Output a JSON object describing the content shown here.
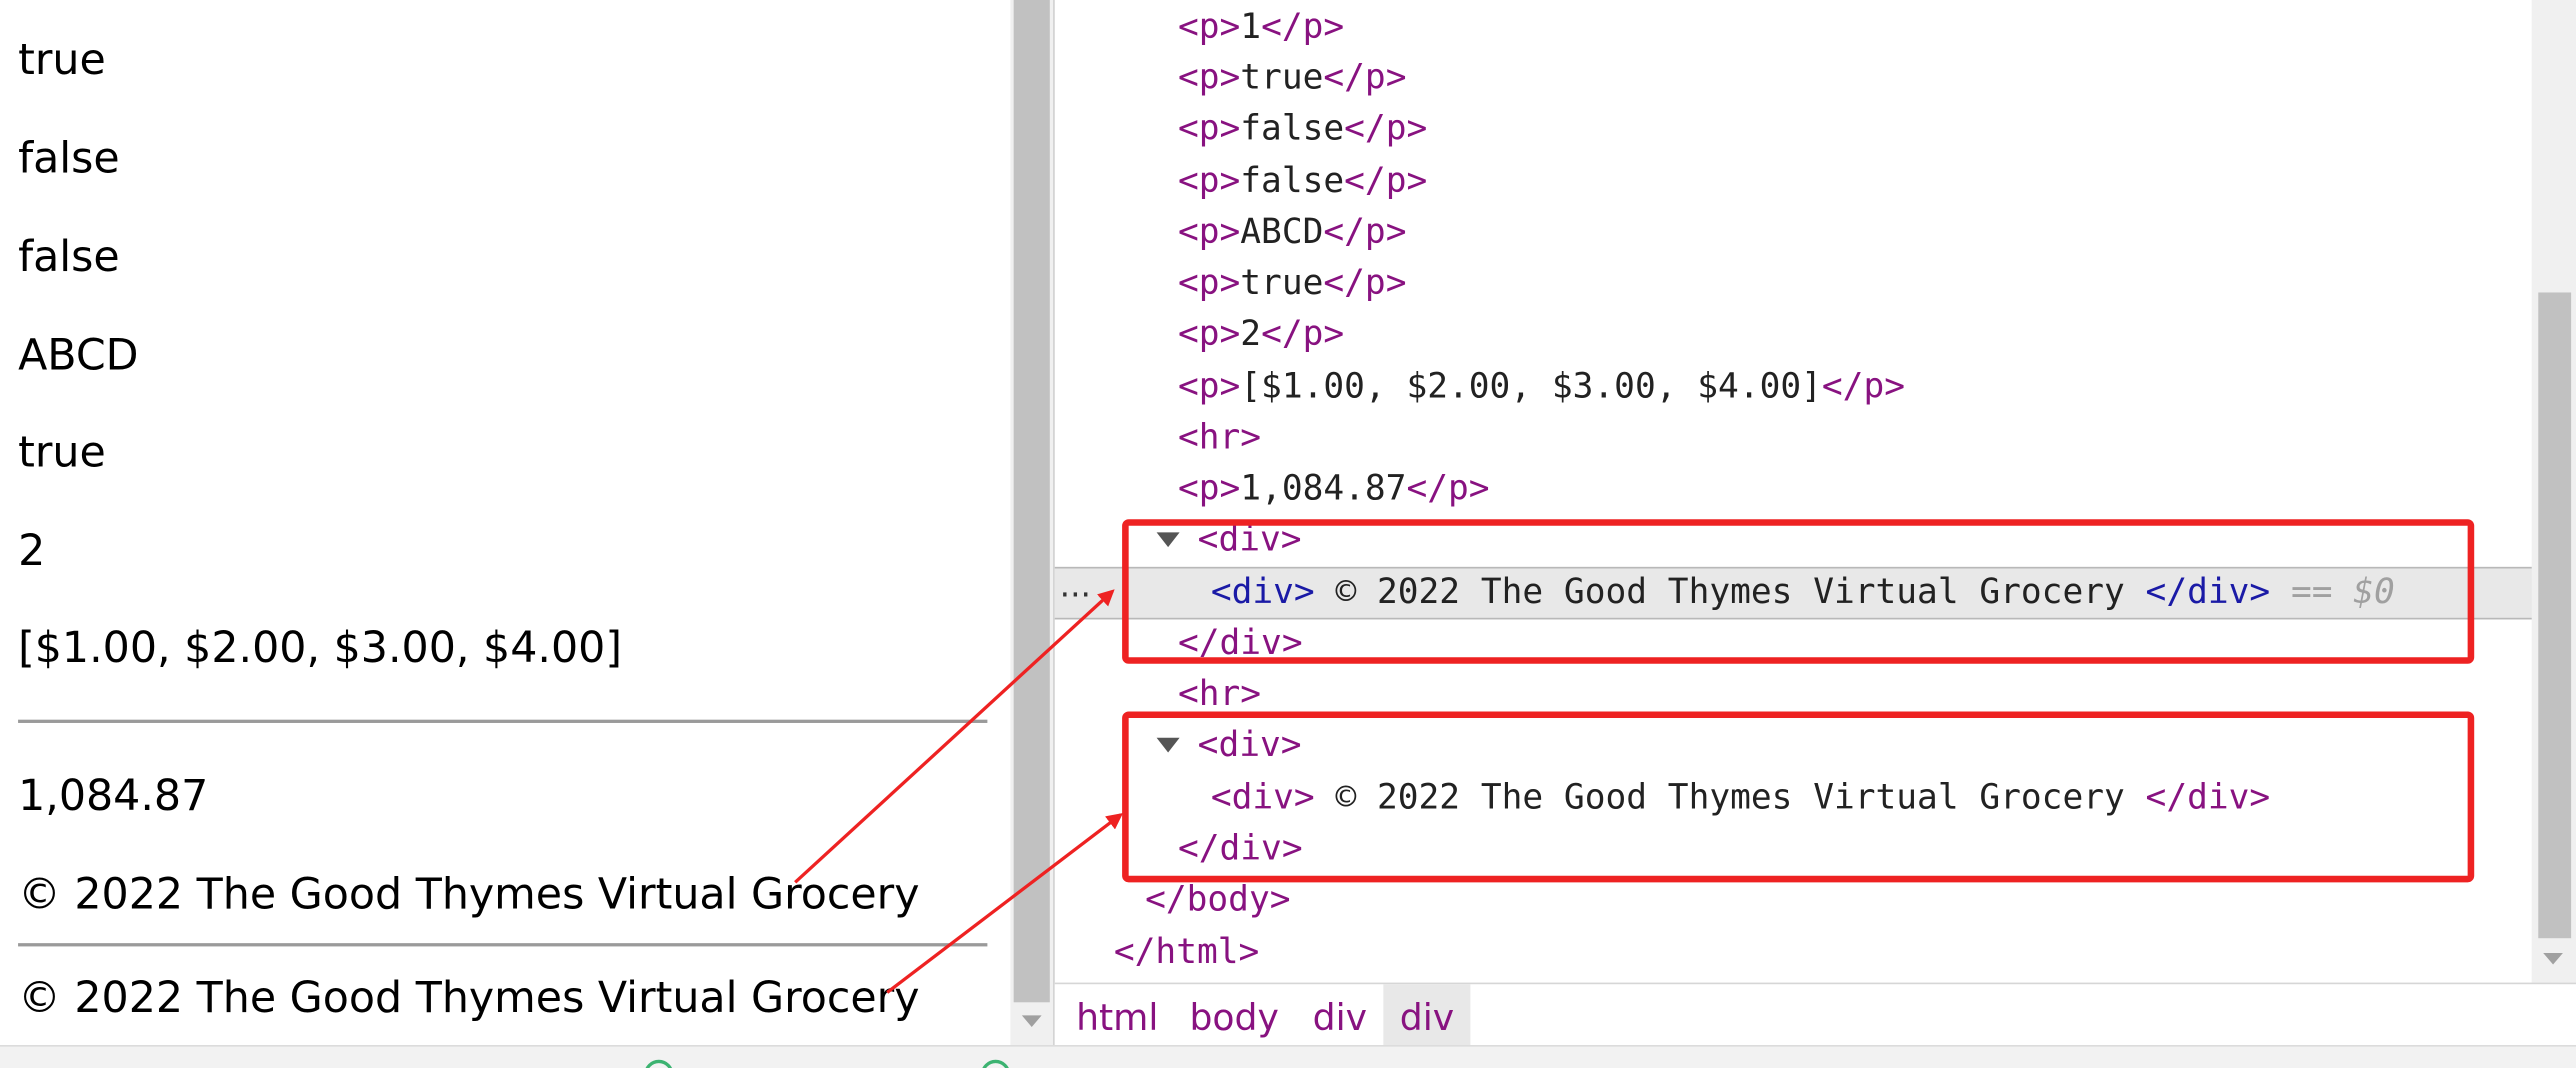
{
  "page": {
    "lines": [
      "true",
      "false",
      "false",
      "ABCD",
      "true",
      "2",
      "[$1.00, $2.00, $3.00, $4.00]"
    ],
    "number": "1,084.87",
    "footer_text_1": "© 2022 The Good Thymes Virtual Grocery",
    "footer_text_2": "© 2022 The Good Thymes Virtual Grocery"
  },
  "devtools": {
    "lines": {
      "l1": "1",
      "l2": "true",
      "l3": "false",
      "l4": "false",
      "l5": "ABCD",
      "l6": "true",
      "l7": "2",
      "l8": "[$1.00, $2.00, $3.00, $4.00]",
      "l10": "1,084.87"
    },
    "div_text_1": " © 2022 The Good Thymes Virtual Grocery ",
    "div_text_2": " © 2022 The Good Thymes Virtual Grocery ",
    "selected_marker": "== $0",
    "ellipsis": "...",
    "tags": {
      "p_open": "<p>",
      "p_close": "</p>",
      "hr": "<hr>",
      "div_open": "<div>",
      "div_close": "</div>",
      "body_close": "</body>",
      "html_close": "</html>"
    }
  },
  "breadcrumb": [
    "html",
    "body",
    "div",
    "div"
  ],
  "colors": {
    "highlight_box": "#ee2222",
    "tag": "#881280",
    "closing_tag": "#1a1aa6"
  }
}
